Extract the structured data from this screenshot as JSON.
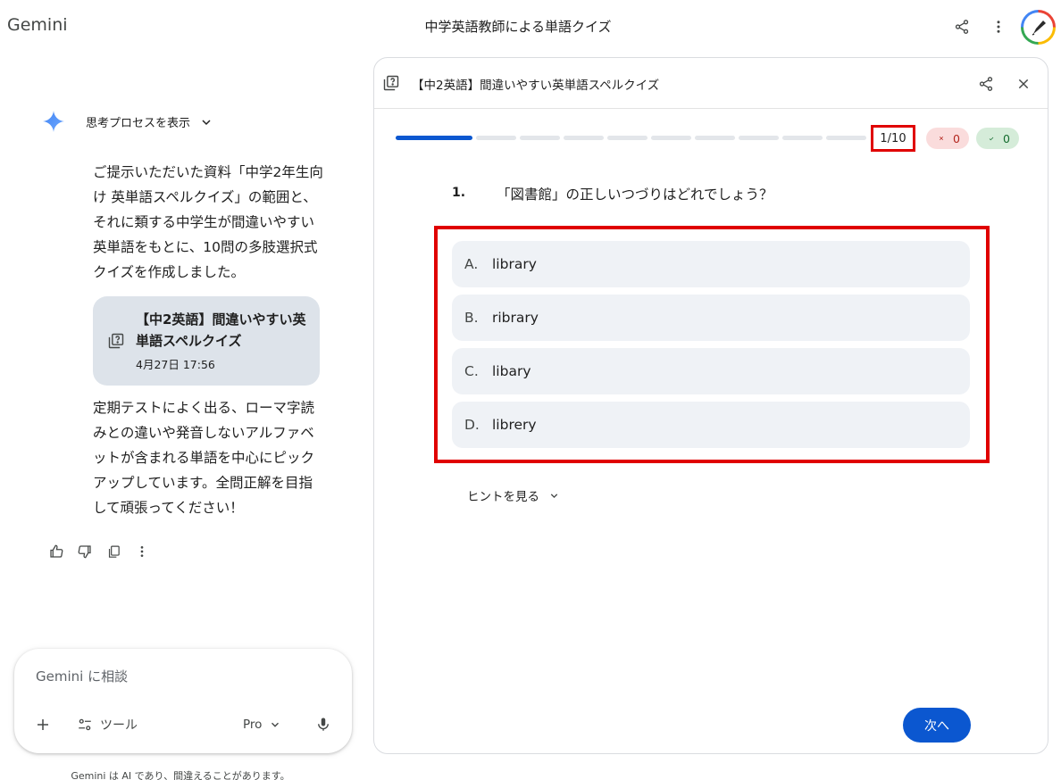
{
  "app": {
    "name": "Gemini"
  },
  "header": {
    "conversation_title": "中学英語教師による単語クイズ"
  },
  "chat": {
    "thinking_label": "思考プロセスを表示",
    "message_intro": "ご提示いただいた資料「中学2年生向け 英単語スペルクイズ」の範囲と、それに類する中学生が間違いやすい英単語をもとに、10問の多肢選択式クイズを作成しました。",
    "doc_chip": {
      "title": "【中2英語】間違いやすい英単語スペルクイズ",
      "date": "4月27日 17:56"
    },
    "message_outro": "定期テストによく出る、ローマ字読みとの違いや発音しないアルファベットが含まれる単語を中心にピックアップしています。全問正解を目指して頑張ってください！"
  },
  "composer": {
    "placeholder": "Gemini に相談",
    "tools_label": "ツール",
    "model_label": "Pro"
  },
  "disclaimer": "Gemini は AI であり、間違えることがあります。",
  "quiz": {
    "title": "【中2英語】間違いやすい英単語スペルクイズ",
    "progress": {
      "current": 1,
      "total": 10,
      "label": "1/10"
    },
    "score": {
      "wrong": "0",
      "correct": "0"
    },
    "question": {
      "number": "1.",
      "text": "「図書館」の正しいつづりはどれでしょう？"
    },
    "options": [
      {
        "letter": "A.",
        "text": "library"
      },
      {
        "letter": "B.",
        "text": "ribrary"
      },
      {
        "letter": "C.",
        "text": "libary"
      },
      {
        "letter": "D.",
        "text": "librery"
      }
    ],
    "hint_label": "ヒントを見る",
    "next_label": "次へ"
  },
  "colors": {
    "accent": "#0b57d0",
    "highlight_box": "#e00000",
    "option_bg": "#eff2f6",
    "wrong_pill_bg": "#fadcdc",
    "correct_pill_bg": "#d5ecd9"
  },
  "icons": {
    "share": "share-icon",
    "more": "more-vert-icon",
    "quiz": "quiz-icon",
    "close": "close-icon",
    "spark": "gemini-spark-icon",
    "chevron": "chevron-down-icon",
    "mic": "mic-icon",
    "plus": "plus-icon",
    "tools": "tools-icon"
  }
}
